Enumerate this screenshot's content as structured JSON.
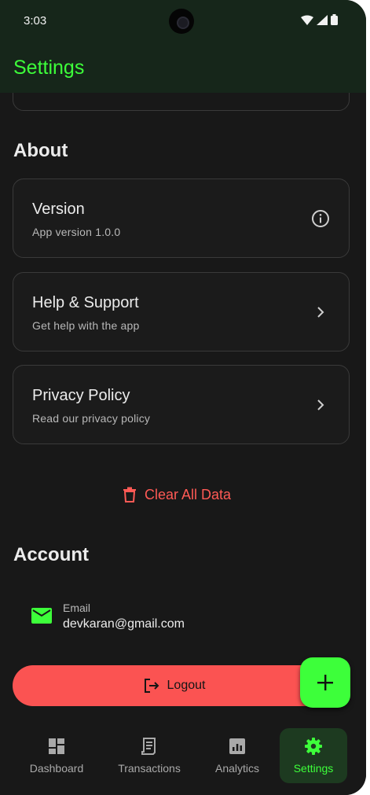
{
  "status_bar": {
    "time": "3:03"
  },
  "app_bar": {
    "title": "Settings"
  },
  "about": {
    "heading": "About",
    "items": [
      {
        "title": "Version",
        "subtitle": "App version 1.0.0",
        "icon": "info-icon"
      },
      {
        "title": "Help & Support",
        "subtitle": "Get help with the app",
        "icon": "chevron-right-icon"
      },
      {
        "title": "Privacy Policy",
        "subtitle": "Read our privacy policy",
        "icon": "chevron-right-icon"
      }
    ]
  },
  "clear_data": {
    "label": "Clear All Data",
    "icon": "trash-icon",
    "color": "#ff5a55"
  },
  "account": {
    "heading": "Account",
    "email_label": "Email",
    "email_value": "devkaran@gmail.com",
    "email_icon": "mail-icon"
  },
  "logout": {
    "label": "Logout",
    "icon": "logout-icon",
    "color": "#fb5352"
  },
  "fab": {
    "icon": "plus-icon",
    "color": "#3dff3a"
  },
  "bottom_nav": {
    "items": [
      {
        "label": "Dashboard",
        "icon": "dashboard-icon",
        "active": false
      },
      {
        "label": "Transactions",
        "icon": "receipt-icon",
        "active": false
      },
      {
        "label": "Analytics",
        "icon": "analytics-icon",
        "active": false
      },
      {
        "label": "Settings",
        "icon": "gear-icon",
        "active": true
      }
    ]
  },
  "colors": {
    "accent": "#3dff3a",
    "background": "#181818",
    "app_bar": "#16261a",
    "danger": "#fb5352"
  }
}
